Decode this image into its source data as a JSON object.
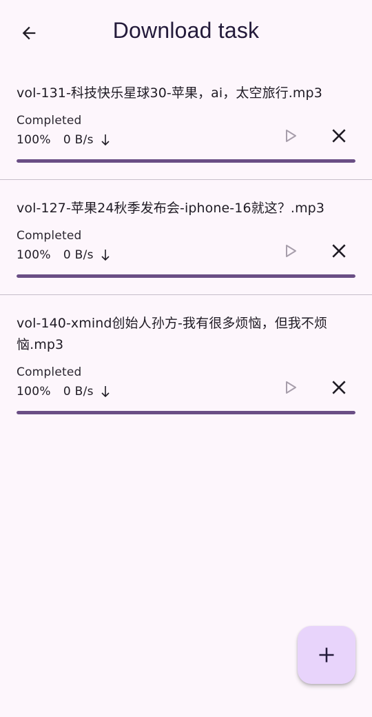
{
  "header": {
    "title": "Download task",
    "back_icon": "arrow-back-icon"
  },
  "tasks": [
    {
      "name": "vol-131-科技快乐星球30-苹果，ai，太空旅行.mp3",
      "status": "Completed",
      "percent": "100%",
      "speed": "0 B/s",
      "progress": 1.0
    },
    {
      "name": "vol-127-苹果24秋季发布会-iphone-16就这？.mp3",
      "status": "Completed",
      "percent": "100%",
      "speed": "0 B/s",
      "progress": 1.0
    },
    {
      "name": "vol-140-xmind创始人孙方-我有很多烦恼，但我不烦恼.mp3",
      "status": "Completed",
      "percent": "100%",
      "speed": "0 B/s",
      "progress": 1.0
    }
  ],
  "icons": {
    "play": "play-icon",
    "cancel": "close-icon",
    "download_arrow": "arrow-down-icon",
    "add": "plus-icon"
  },
  "colors": {
    "background": "#fdf6fc",
    "progress_fill": "#6a4e85",
    "fab": "#e8d4fb",
    "play_disabled": "#a79eab"
  }
}
